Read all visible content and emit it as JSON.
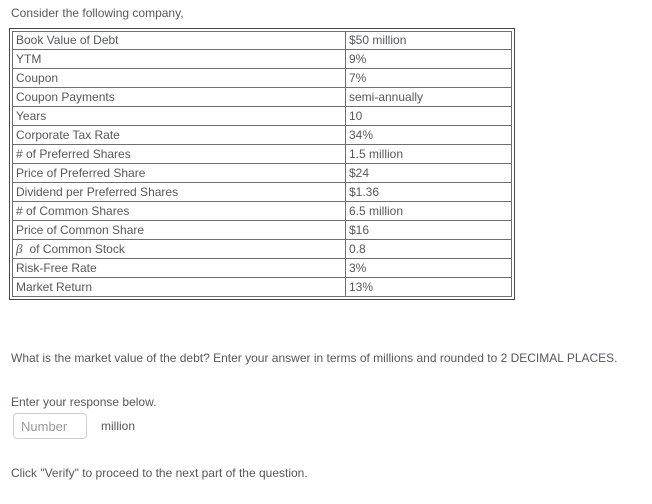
{
  "intro": {
    "text": "Consider the following company,"
  },
  "table": {
    "rows": [
      {
        "label": "Book Value of Debt",
        "value": "$50 million"
      },
      {
        "label": "YTM",
        "value": "9%"
      },
      {
        "label": "Coupon",
        "value": "7%"
      },
      {
        "label": "Coupon Payments",
        "value": "semi-annually"
      },
      {
        "label": "Years",
        "value": "10"
      },
      {
        "label": "Corporate Tax Rate",
        "value": "34%"
      },
      {
        "label": "# of Preferred Shares",
        "value": "1.5 million"
      },
      {
        "label": "Price of Preferred Share",
        "value": "$24"
      },
      {
        "label": "Dividend per Preferred Shares",
        "value": "$1.36"
      },
      {
        "label": "# of Common Shares",
        "value": "6.5 million"
      },
      {
        "label": "Price of Common Share",
        "value": "$16"
      },
      {
        "label": "beta_symbol",
        "value": "0.8",
        "beta": "β",
        "label_suffix": "of Common Stock"
      },
      {
        "label": "Risk-Free Rate",
        "value": "3%"
      },
      {
        "label": "Market Return",
        "value": "13%"
      }
    ]
  },
  "question": {
    "prompt": "What is the market value of the debt? Enter your answer in terms of millions and rounded to 2 DECIMAL PLACES.",
    "response_label": "Enter your response below.",
    "input_value": "",
    "input_placeholder": "Number",
    "unit": "million",
    "verify_hint": "Click \"Verify\" to proceed to the next part of the question."
  }
}
